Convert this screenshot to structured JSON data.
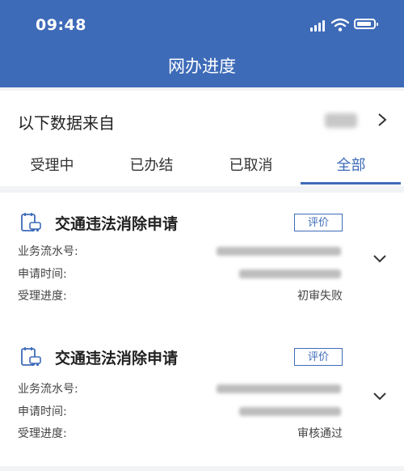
{
  "status_bar": {
    "time": "09:48"
  },
  "header": {
    "title": "网办进度"
  },
  "source": {
    "label": "以下数据来自"
  },
  "tabs": [
    {
      "label": "受理中"
    },
    {
      "label": "已办结"
    },
    {
      "label": "已取消"
    },
    {
      "label": "全部",
      "active": true
    }
  ],
  "cards": [
    {
      "title": "交通违法消除申请",
      "rate_label": "评价",
      "serial_label": "业务流水号:",
      "time_label": "申请时间:",
      "progress_label": "受理进度:",
      "progress_value": "初审失败"
    },
    {
      "title": "交通违法消除申请",
      "rate_label": "评价",
      "serial_label": "业务流水号:",
      "time_label": "申请时间:",
      "progress_label": "受理进度:",
      "progress_value": "审核通过"
    }
  ],
  "colors": {
    "accent": "#3e6bb8",
    "background": "#f2f3f5"
  }
}
